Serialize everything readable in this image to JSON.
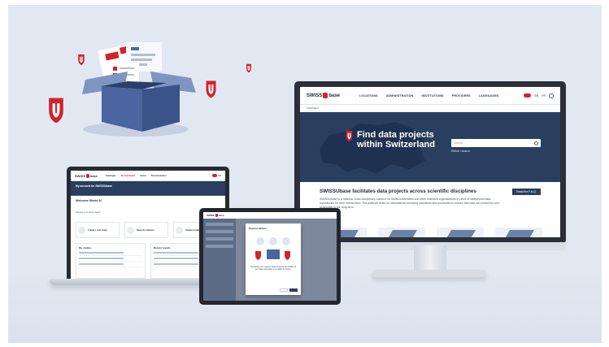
{
  "brand": {
    "name_prefix": "SWISS",
    "name_suffix": "base",
    "accent_color": "#d2232a",
    "navy_color": "#2a3f5f"
  },
  "monitor": {
    "nav_links": [
      "LOCATIONS",
      "ADMINISTRATION",
      "INSTITUTIONS",
      "PROVIDERS",
      "LANGUAGES"
    ],
    "lang": "EN",
    "lang_alt": "FR",
    "breadcrumb": "Catalogue",
    "hero_title": "Find data projects within Switzerland",
    "search_placeholder": "Search...",
    "advanced_search": "Refine / search",
    "section_title": "SWISSUbase facilitates data projects across scientific disciplines",
    "section_text": "SWISSUbase is a national cross-disciplinary solution for Swiss universities and other research organizations in need of institutional data repositories for their researchers. The platform relies on international archiving standards and processes to ensure that data are preserved and accessible in the long-term.",
    "cta_label": "Read the F.A.Q."
  },
  "laptop": {
    "nav_links": [
      "Catalogue",
      "My dashboard",
      "About",
      "Documentation"
    ],
    "active_link": "My dashboard",
    "banner": "My account for SWISSUbase",
    "welcome_title": "Welcome Shield A!",
    "welcome_sub": "Manage your data projects",
    "tiles": [
      "Create a new study",
      "Deposit a dataset",
      "Update profile"
    ],
    "panel_left": "My studies",
    "panel_right": "Recent results"
  },
  "tablet": {
    "dialog_title": "Request dataset",
    "dialog_text": "Depositing your research data increases the visibility of your data and makes it re-usable by others."
  }
}
